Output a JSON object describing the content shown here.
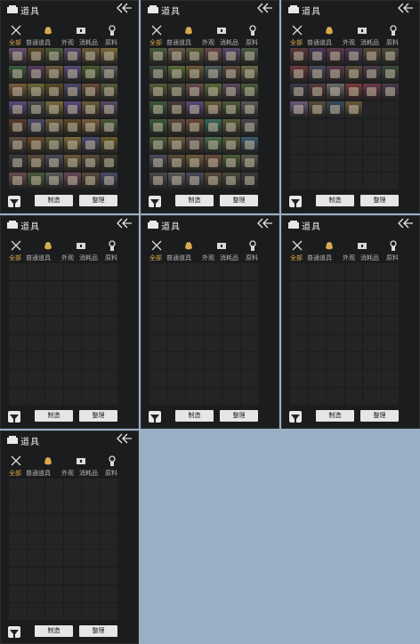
{
  "ui": {
    "title": "道具",
    "tabs": [
      "全部",
      "普通道具",
      "外观",
      "消耗品",
      "原料"
    ],
    "active_tab": "全部",
    "craft_label": "制造",
    "sort_label": "整理"
  },
  "colors": {
    "accent": "#d9a84a",
    "tab_text": "#b5b5b5",
    "panel_bg": "#1b1c1e",
    "slot_bg": "#232426",
    "button_bg": "#e6e6e6",
    "outer_bg": "#9aafc4"
  },
  "icons": {
    "header": "bag-icon",
    "back": "back-arrow-icon",
    "close": "close-icon",
    "category_all": "pouch-icon",
    "category_chest": "chest-icon",
    "category_badge": "badge-icon",
    "filter": "filter-icon"
  },
  "panels": [
    {
      "id": "p1",
      "items": [
        {
          "c": "#6a5070"
        },
        {
          "c": "#5a4a2a"
        },
        {
          "c": "#4a5a3a"
        },
        {
          "c": "#5a4a6a"
        },
        {
          "c": "#6a5a3a"
        },
        {
          "c": "#7a6a3a"
        },
        {
          "c": "#3a5a3a"
        },
        {
          "c": "#5a3a5a"
        },
        {
          "c": "#6a5a3a"
        },
        {
          "c": "#5a4a7a"
        },
        {
          "c": "#4a5a2a"
        },
        {
          "c": "#5a5a5a"
        },
        {
          "c": "#7a5a3a"
        },
        {
          "c": "#6a6a3a"
        },
        {
          "c": "#5a4a2a"
        },
        {
          "c": "#4a4a6a"
        },
        {
          "c": "#6a4a3a"
        },
        {
          "c": "#5a5a3a"
        },
        {
          "c": "#5a4a7a"
        },
        {
          "c": "#4a4a4a"
        },
        {
          "c": "#7a6a3a"
        },
        {
          "c": "#5a4a7a"
        },
        {
          "c": "#6a5a3a"
        },
        {
          "c": "#5a4a6a"
        },
        {
          "c": "#5a3a2a"
        },
        {
          "c": "#4a4a6a"
        },
        {
          "c": "#6a5a3a"
        },
        {
          "c": "#5a4a2a"
        },
        {
          "c": "#7a5a3a"
        },
        {
          "c": "#4a5a3a"
        },
        {
          "c": "#5a4a3a"
        },
        {
          "c": "#6a4a2a"
        },
        {
          "c": "#5a5a3a"
        },
        {
          "c": "#7a6a3a"
        },
        {
          "c": "#4a4a6a"
        },
        {
          "c": "#6a5a2a"
        },
        {
          "c": "#3a3a3a"
        },
        {
          "c": "#5a4a3a"
        },
        {
          "c": "#4a4a5a"
        },
        {
          "c": "#6a5a3a"
        },
        {
          "c": "#5a4a3a"
        },
        {
          "c": "#3a3a2a"
        },
        {
          "c": "#6a4a4a"
        },
        {
          "c": "#4a5a3a"
        },
        {
          "c": "#5a5a5a"
        },
        {
          "c": "#6a4a5a"
        },
        {
          "c": "#5a4a3a"
        },
        {
          "c": "#4a4a6a"
        }
      ]
    },
    {
      "id": "p2",
      "items": [
        {
          "c": "#4a5a3a"
        },
        {
          "c": "#6a5a4a"
        },
        {
          "c": "#5a5a3a"
        },
        {
          "c": "#6a4a4a"
        },
        {
          "c": "#5a4a6a"
        },
        {
          "c": "#4a5a4a"
        },
        {
          "c": "#3a4a3a"
        },
        {
          "c": "#5a6a3a"
        },
        {
          "c": "#6a5a3a"
        },
        {
          "c": "#4a5a5a"
        },
        {
          "c": "#5a4a3a"
        },
        {
          "c": "#6a6a4a"
        },
        {
          "c": "#5a5a3a"
        },
        {
          "c": "#4a4a3a"
        },
        {
          "c": "#6a4a4a"
        },
        {
          "c": "#5a6a3a"
        },
        {
          "c": "#5a4a5a"
        },
        {
          "c": "#4a5a3a"
        },
        {
          "c": "#3a5a3a"
        },
        {
          "c": "#4a3a3a"
        },
        {
          "c": "#5a4a7a"
        },
        {
          "c": "#6a5a3a"
        },
        {
          "c": "#4a5a3a"
        },
        {
          "c": "#5a5a5a"
        },
        {
          "c": "#3a5a3a"
        },
        {
          "c": "#5a4a3a"
        },
        {
          "c": "#6a4a3a"
        },
        {
          "c": "#3a6a5a"
        },
        {
          "c": "#5a5a3a"
        },
        {
          "c": "#4a4a4a"
        },
        {
          "c": "#4a5a3a"
        },
        {
          "c": "#6a5a3a"
        },
        {
          "c": "#5a4a4a"
        },
        {
          "c": "#4a6a4a"
        },
        {
          "c": "#5a5a3a"
        },
        {
          "c": "#3a5a6a"
        },
        {
          "c": "#4a4a5a"
        },
        {
          "c": "#5a4a3a"
        },
        {
          "c": "#6a5a3a"
        },
        {
          "c": "#6a4a3a"
        },
        {
          "c": "#4a5a3a"
        },
        {
          "c": "#5a5a4a"
        },
        {
          "c": "#4a4a4a"
        },
        {
          "c": "#5a5a5a"
        },
        {
          "c": "#4a4a5a"
        },
        {
          "c": "#5a4a3a"
        },
        {
          "c": "#4a4a3a"
        },
        {
          "c": "#3a3a3a"
        }
      ]
    },
    {
      "id": "p3",
      "items": [
        {
          "c": "#5a3a3a"
        },
        {
          "c": "#4a3a5a"
        },
        {
          "c": "#5a3a4a"
        },
        {
          "c": "#4a3a5a"
        },
        {
          "c": "#5a4a3a"
        },
        {
          "c": "#4a4a3a"
        },
        {
          "c": "#6a3a3a"
        },
        {
          "c": "#4a4a5a"
        },
        {
          "c": "#5a3a4a"
        },
        {
          "c": "#5a4a3a"
        },
        {
          "c": "#4a3a4a"
        },
        {
          "c": "#3a4a3a"
        },
        {
          "c": "#3a3a4a"
        },
        {
          "c": "#5a3a3a"
        },
        {
          "c": "#6a6a6a"
        },
        {
          "c": "#7a3a3a"
        },
        {
          "c": "#6a3a4a"
        },
        {
          "c": "#4a3a4a"
        },
        {
          "c": "#6a5a7a"
        },
        {
          "c": "#5a4a3a"
        },
        {
          "c": "#3a4a5a"
        },
        {
          "c": "#6a5a3a"
        }
      ]
    },
    {
      "id": "p4",
      "items": []
    },
    {
      "id": "p5",
      "items": []
    },
    {
      "id": "p6",
      "items": []
    },
    {
      "id": "p7",
      "items": []
    }
  ]
}
